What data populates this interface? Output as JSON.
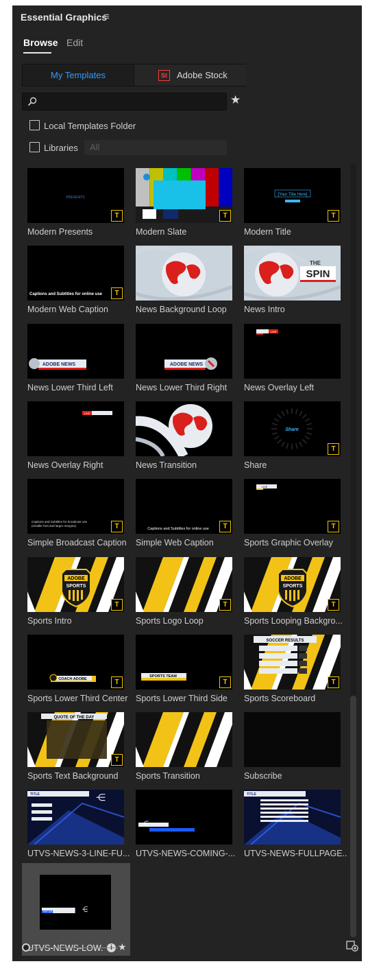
{
  "panel": {
    "title": "Essential Graphics",
    "menu_glyph": "≡"
  },
  "tabs": [
    {
      "label": "Browse",
      "active": true
    },
    {
      "label": "Edit",
      "active": false
    }
  ],
  "source_toggle": {
    "left": "My Templates",
    "right": "Adobe Stock",
    "stock_logo": "St",
    "accent": "#2d9cff"
  },
  "search": {
    "value": "",
    "placeholder": ""
  },
  "filters": {
    "local_templates": {
      "label": "Local Templates Folder",
      "checked": false
    },
    "libraries": {
      "label": "Libraries",
      "checked": false,
      "select_value": "All"
    }
  },
  "badge_text": "T",
  "templates": [
    {
      "name": "Modern Presents",
      "thumb": "presents",
      "badge": true
    },
    {
      "name": "Modern Slate",
      "thumb": "slate",
      "badge": true
    },
    {
      "name": "Modern Title",
      "thumb": "title",
      "badge": true,
      "text": "[Your Title Here]"
    },
    {
      "name": "Modern Web Caption",
      "thumb": "caption",
      "badge": true,
      "text": "Captions and Subtitles for online use"
    },
    {
      "name": "News Background Loop",
      "thumb": "globe",
      "badge": false
    },
    {
      "name": "News Intro",
      "thumb": "spin",
      "badge": false,
      "text": "SPIN"
    },
    {
      "name": "News Lower Third Left",
      "thumb": "lt-left",
      "badge": false,
      "text": "ADOBE NEWS"
    },
    {
      "name": "News Lower Third Right",
      "thumb": "lt-right",
      "badge": false,
      "text": "ADOBE NEWS"
    },
    {
      "name": "News Overlay Left",
      "thumb": "ov-left",
      "badge": false,
      "text": "LIVE"
    },
    {
      "name": "News Overlay Right",
      "thumb": "ov-right",
      "badge": false,
      "text": "LIVE"
    },
    {
      "name": "News Transition",
      "thumb": "transition",
      "badge": false
    },
    {
      "name": "Share",
      "thumb": "share",
      "badge": true,
      "text": "Share"
    },
    {
      "name": "Simple Broadcast Caption",
      "thumb": "bcaption",
      "badge": true,
      "text": "Captions and Subtitles for broadcast use"
    },
    {
      "name": "Simple Web Caption",
      "thumb": "wcaption",
      "badge": true,
      "text": "Captions and Subtitles for online use"
    },
    {
      "name": "Sports Graphic Overlay",
      "thumb": "sp-overlay",
      "badge": true,
      "text": "LIVE"
    },
    {
      "name": "Sports Intro",
      "thumb": "sp-intro",
      "badge": true,
      "text": "ADOBE SPORTS"
    },
    {
      "name": "Sports Logo Loop",
      "thumb": "sp-logo",
      "badge": true
    },
    {
      "name": "Sports Looping Backgro...",
      "thumb": "sp-intro",
      "badge": true,
      "text": "ADOBE SPORTS"
    },
    {
      "name": "Sports Lower Third Center",
      "thumb": "sp-ltc",
      "badge": true,
      "text": "COACH ADOBE"
    },
    {
      "name": "Sports Lower Third Side",
      "thumb": "sp-lts",
      "badge": true,
      "text": "SPORTS TEAM"
    },
    {
      "name": "Sports Scoreboard",
      "thumb": "sp-score",
      "badge": true,
      "text": "SOCCER RESULTS"
    },
    {
      "name": "Sports Text Background",
      "thumb": "sp-quote",
      "badge": true,
      "text": "QUOTE OF THE DAY"
    },
    {
      "name": "Sports Transition",
      "thumb": "sp-trans",
      "badge": false
    },
    {
      "name": "Subscribe",
      "thumb": "subscribe",
      "badge": false
    },
    {
      "name": "UTVS-NEWS-3-LINE-FU...",
      "thumb": "utvs-3",
      "badge": false,
      "text": "TITLE"
    },
    {
      "name": "UTVS-NEWS-COMING-...",
      "thumb": "utvs-coming",
      "badge": false
    },
    {
      "name": "UTVS-NEWS-FULLPAGE...",
      "thumb": "utvs-full",
      "badge": false,
      "text": "TITLE"
    },
    {
      "name": "UTVS-NEWS-LOW...",
      "thumb": "utvs-low",
      "badge": false,
      "selected": true,
      "text": "FIRST LINE"
    }
  ],
  "selected_actions": {
    "info": "i",
    "favorite": "★"
  },
  "footer": {
    "zoom_level": 0,
    "new_layer_icon": "new-layer-icon"
  }
}
